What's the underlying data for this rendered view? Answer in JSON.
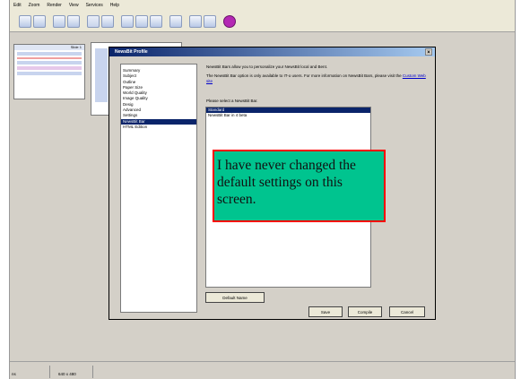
{
  "menu": [
    "Edit",
    "Zoom",
    "Render",
    "View",
    "Services",
    "Help"
  ],
  "toolbar": {
    "icons": [
      "new-icon",
      "open-icon",
      "cut-icon",
      "copy-icon",
      "paste-icon",
      "undo-icon",
      "redo-icon",
      "save-icon",
      "print-icon",
      "preview-icon",
      "find-icon",
      "image-icon",
      "color-icon"
    ]
  },
  "thumbnails": {
    "slide1_label": "Slide 1"
  },
  "dialog": {
    "title": "NewsBit Profile",
    "close": "×",
    "nav_items": [
      "Summary",
      "Subject",
      "Outline",
      "Paper Size",
      "World Quality",
      "Image Quality",
      "Desig",
      "Advanced",
      "Settings",
      "NewsBit Bar",
      "HTML Edition"
    ],
    "selected_nav": "NewsBit Bar",
    "description_1": "NewsBit Bars allow you to personalize your NewsBit local and Bent.",
    "description_2": "The NewsBit Bar option is only available to IT-o users. For more information on NewsBit Bars, please visit the",
    "description_link": "Custom Web site",
    "select_prompt": "Please select a NewsBit Bar.",
    "profiles": [
      "Standard",
      "NewsBit Bar in 4 beta"
    ],
    "selected_profile": "Standard",
    "default_button": "Default Name",
    "save_button": "Save",
    "compile_button": "Compile",
    "cancel_button": "Cancel"
  },
  "callout": {
    "text": "I have never changed the default settings on this screen."
  },
  "statusbar": {
    "left": "ns",
    "zoom": "640 x 480"
  }
}
